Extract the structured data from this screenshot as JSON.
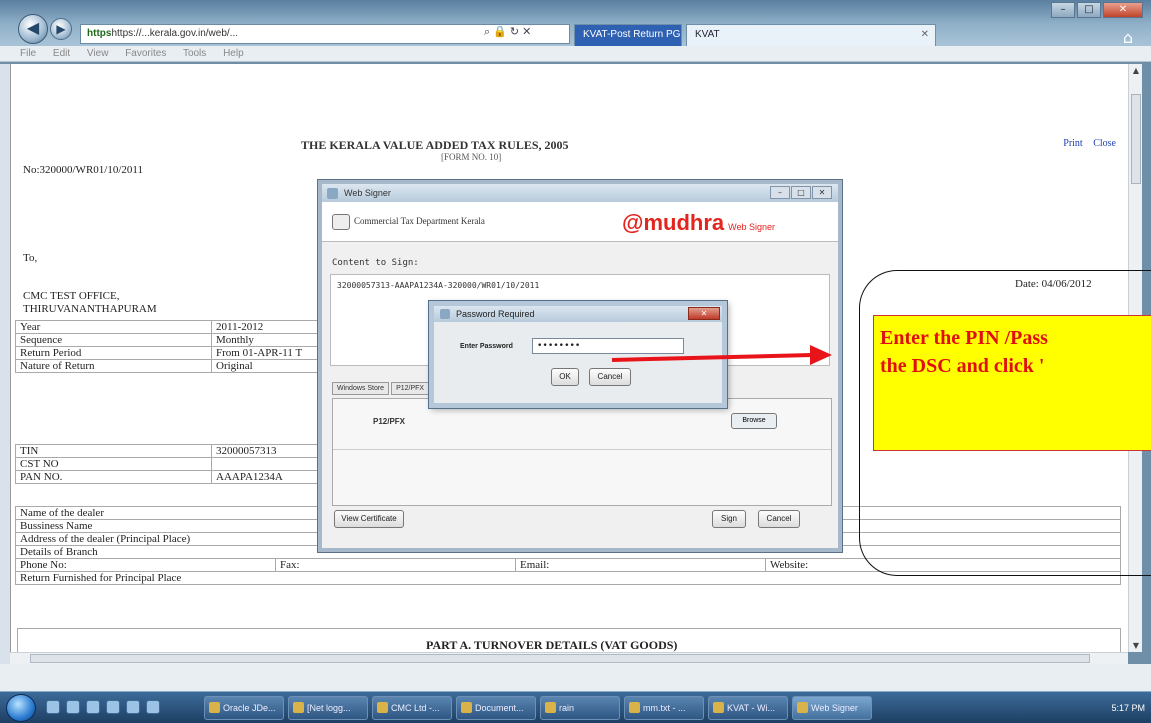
{
  "browser": {
    "url": "https://...kerala.gov.in/web/...",
    "url_scheme": "https",
    "tabs": [
      {
        "label": "KVAT-Post Return PGDS",
        "active": true
      },
      {
        "label": "KVAT",
        "active": false
      }
    ],
    "menu": [
      "File",
      "Edit",
      "View",
      "Favorites",
      "Tools",
      "Help"
    ]
  },
  "page": {
    "links": {
      "print": "Print",
      "close": "Close"
    },
    "doc_no": "No:320000/WR01/10/2011",
    "rules_title": "THE KERALA VALUE ADDED TAX RULES, 2005",
    "rules_sub": "[FORM NO. 10]",
    "to_label": "To,",
    "office_line1": "CMC TEST OFFICE,",
    "office_line2": "THIRUVANANTHAPURAM",
    "date": "Date: 04/06/2012",
    "info_rows": [
      {
        "label": "Year",
        "value": "2011-2012"
      },
      {
        "label": "Sequence",
        "value": "Monthly"
      },
      {
        "label": "Return Period",
        "value": "From 01-APR-11 T"
      },
      {
        "label": "Nature of Return",
        "value": "Original"
      }
    ],
    "id_rows": [
      {
        "label": "TIN",
        "value": "32000057313"
      },
      {
        "label": "CST NO",
        "value": ""
      },
      {
        "label": "PAN NO.",
        "value": "AAAPA1234A"
      }
    ],
    "dealer_rows": [
      "Name of the dealer",
      "Bussiness Name",
      "Address of the dealer (Principal Place)",
      "Details of Branch"
    ],
    "contact_row": {
      "phone": "Phone No:",
      "fax": "Fax:",
      "email": "Email:",
      "website": "Website:"
    },
    "return_furnished": "Return Furnished for Principal Place",
    "part_a_title": "PART A. TURNOVER DETAILS (VAT GOODS)"
  },
  "signer": {
    "title": "Web Signer",
    "department": "Commercial Tax Department Kerala",
    "brand": "mudhra",
    "brand_suffix": "Web Signer",
    "content_label": "Content to Sign:",
    "content": "32000057313-AAAPA1234A-320000/WR01/10/2011",
    "store_tabs": [
      "Windows Store",
      "P12/PFX"
    ],
    "p12_label": "P12/PFX",
    "browse_label": "Browse",
    "view_certificate": "View Certificate",
    "sign": "Sign",
    "cancel": "Cancel"
  },
  "password_dialog": {
    "title": "Password Required",
    "label": "Enter Password",
    "value": "••••••••",
    "ok": "OK",
    "cancel": "Cancel"
  },
  "annotation": {
    "line1": "Enter the PIN /Pass",
    "line2": "the DSC and click '"
  },
  "colors": {
    "annotation_bg": "#ffff00",
    "annotation_text": "#e01010",
    "arrow": "#e8141a",
    "brand_red": "#e3251f"
  },
  "taskbar": {
    "tasks": [
      "Oracle JDe...",
      "[Net logg...",
      "CMC Ltd -...",
      "Document...",
      "rain",
      "mm.txt - ...",
      "KVAT - Wi...",
      "Web Signer"
    ],
    "time": "5:17 PM"
  }
}
